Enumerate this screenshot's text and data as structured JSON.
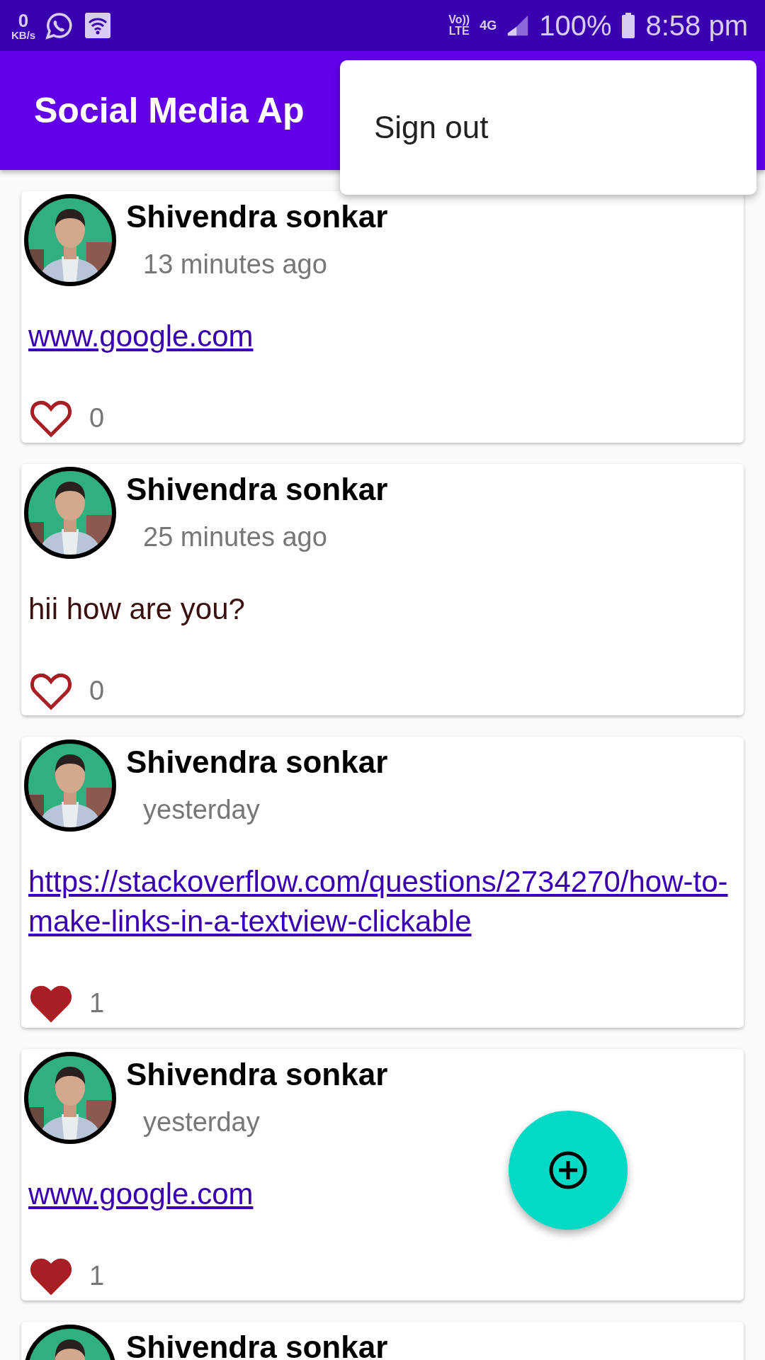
{
  "status_bar": {
    "data_speed": "0",
    "data_unit": "KB/s",
    "volte_top": "Vo))",
    "volte_bottom": "LTE",
    "network": "4G",
    "battery": "100%",
    "time": "8:58 pm"
  },
  "app_bar": {
    "title": "Social Media Ap"
  },
  "menu": {
    "items": [
      "Sign out"
    ]
  },
  "posts": [
    {
      "author": "Shivendra sonkar",
      "time": "13 minutes ago",
      "kind": "link",
      "body": "www.google.com",
      "liked": false,
      "likes": "0"
    },
    {
      "author": "Shivendra sonkar",
      "time": "25 minutes ago",
      "kind": "text",
      "body": "hii how are you?",
      "liked": false,
      "likes": "0"
    },
    {
      "author": "Shivendra sonkar",
      "time": "yesterday",
      "kind": "link",
      "body": "https://stackoverflow.com/questions/2734270/how-to-make-links-in-a-textview-clickable",
      "liked": true,
      "likes": "1"
    },
    {
      "author": "Shivendra sonkar",
      "time": "yesterday",
      "kind": "link",
      "body": "www.google.com",
      "liked": true,
      "likes": "1"
    },
    {
      "author": "Shivendra sonkar",
      "kind": "partial"
    }
  ]
}
